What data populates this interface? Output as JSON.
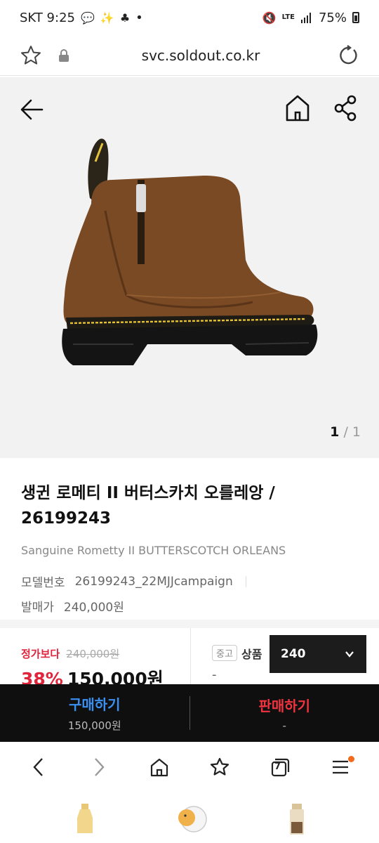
{
  "status_bar": {
    "carrier_time": "SKT 9:25",
    "dot": "•",
    "network": "LTE",
    "battery": "75%"
  },
  "url_bar": {
    "url": "svc.soldout.co.kr"
  },
  "gallery": {
    "current_page": "1",
    "separator": "/",
    "total_pages": "1"
  },
  "product": {
    "title": "생귄 로메티 II 버터스카치 오를레앙 / 26199243",
    "subtitle": "Sanguine Rometty II BUTTERSCOTCH ORLEANS",
    "model_label": "모델번호",
    "model_value": "26199243_22MJJcampaign",
    "release_price_label": "발매가",
    "release_price_value": "240,000원"
  },
  "price": {
    "regular_label": "정가보다",
    "regular_old": "240,000원",
    "discount": "38%",
    "current": "150,000원",
    "used_badge": "중고",
    "used_label": "상품",
    "used_value": "-",
    "size_selected": "240"
  },
  "actions": {
    "buy_label": "구매하기",
    "buy_price": "150,000원",
    "sell_label": "판매하기",
    "sell_price": "-"
  },
  "browser_nav": {
    "tabs_count": "7"
  },
  "colors": {
    "accent_red": "#e0243c",
    "buy_blue": "#3a8ff0",
    "sell_red": "#f0343f",
    "action_bar_bg": "#0f0f0f",
    "notif_orange": "#f26b1d"
  },
  "icons": [
    "star-icon",
    "lock-icon",
    "reload-icon",
    "back-arrow-icon",
    "home-icon",
    "share-icon",
    "chevron-down-icon",
    "chevron-left-icon",
    "chevron-right-icon",
    "browser-home-icon",
    "bookmark-star-icon",
    "tabs-icon",
    "menu-icon"
  ]
}
